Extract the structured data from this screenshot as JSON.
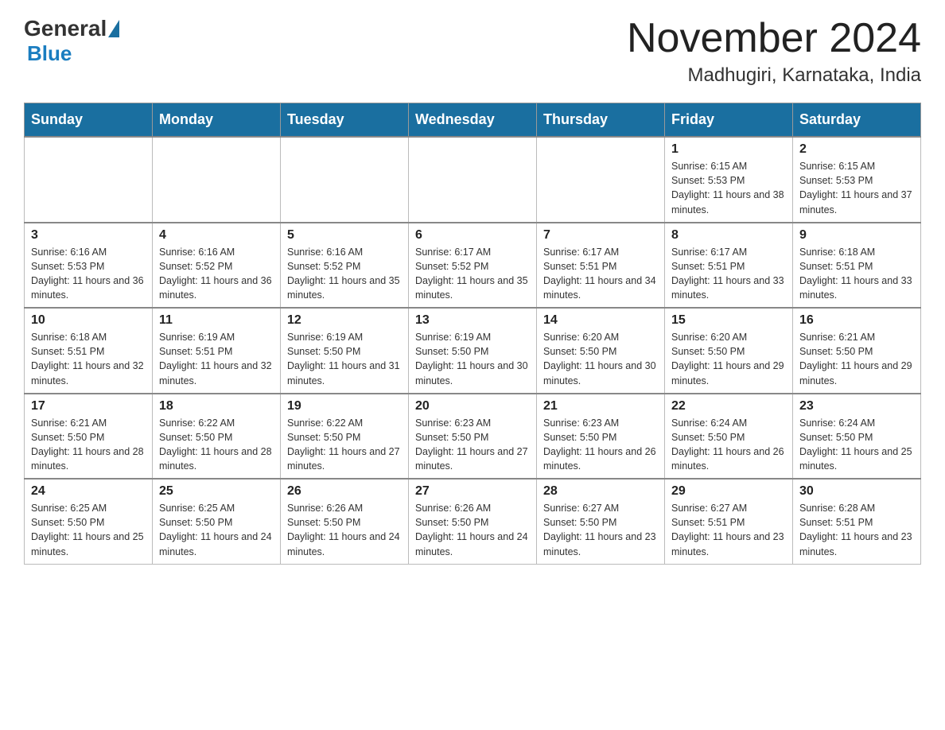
{
  "header": {
    "logo_general": "General",
    "logo_blue": "Blue",
    "month_year": "November 2024",
    "location": "Madhugiri, Karnataka, India"
  },
  "weekdays": [
    "Sunday",
    "Monday",
    "Tuesday",
    "Wednesday",
    "Thursday",
    "Friday",
    "Saturday"
  ],
  "weeks": [
    [
      {
        "day": "",
        "info": ""
      },
      {
        "day": "",
        "info": ""
      },
      {
        "day": "",
        "info": ""
      },
      {
        "day": "",
        "info": ""
      },
      {
        "day": "",
        "info": ""
      },
      {
        "day": "1",
        "info": "Sunrise: 6:15 AM\nSunset: 5:53 PM\nDaylight: 11 hours and 38 minutes."
      },
      {
        "day": "2",
        "info": "Sunrise: 6:15 AM\nSunset: 5:53 PM\nDaylight: 11 hours and 37 minutes."
      }
    ],
    [
      {
        "day": "3",
        "info": "Sunrise: 6:16 AM\nSunset: 5:53 PM\nDaylight: 11 hours and 36 minutes."
      },
      {
        "day": "4",
        "info": "Sunrise: 6:16 AM\nSunset: 5:52 PM\nDaylight: 11 hours and 36 minutes."
      },
      {
        "day": "5",
        "info": "Sunrise: 6:16 AM\nSunset: 5:52 PM\nDaylight: 11 hours and 35 minutes."
      },
      {
        "day": "6",
        "info": "Sunrise: 6:17 AM\nSunset: 5:52 PM\nDaylight: 11 hours and 35 minutes."
      },
      {
        "day": "7",
        "info": "Sunrise: 6:17 AM\nSunset: 5:51 PM\nDaylight: 11 hours and 34 minutes."
      },
      {
        "day": "8",
        "info": "Sunrise: 6:17 AM\nSunset: 5:51 PM\nDaylight: 11 hours and 33 minutes."
      },
      {
        "day": "9",
        "info": "Sunrise: 6:18 AM\nSunset: 5:51 PM\nDaylight: 11 hours and 33 minutes."
      }
    ],
    [
      {
        "day": "10",
        "info": "Sunrise: 6:18 AM\nSunset: 5:51 PM\nDaylight: 11 hours and 32 minutes."
      },
      {
        "day": "11",
        "info": "Sunrise: 6:19 AM\nSunset: 5:51 PM\nDaylight: 11 hours and 32 minutes."
      },
      {
        "day": "12",
        "info": "Sunrise: 6:19 AM\nSunset: 5:50 PM\nDaylight: 11 hours and 31 minutes."
      },
      {
        "day": "13",
        "info": "Sunrise: 6:19 AM\nSunset: 5:50 PM\nDaylight: 11 hours and 30 minutes."
      },
      {
        "day": "14",
        "info": "Sunrise: 6:20 AM\nSunset: 5:50 PM\nDaylight: 11 hours and 30 minutes."
      },
      {
        "day": "15",
        "info": "Sunrise: 6:20 AM\nSunset: 5:50 PM\nDaylight: 11 hours and 29 minutes."
      },
      {
        "day": "16",
        "info": "Sunrise: 6:21 AM\nSunset: 5:50 PM\nDaylight: 11 hours and 29 minutes."
      }
    ],
    [
      {
        "day": "17",
        "info": "Sunrise: 6:21 AM\nSunset: 5:50 PM\nDaylight: 11 hours and 28 minutes."
      },
      {
        "day": "18",
        "info": "Sunrise: 6:22 AM\nSunset: 5:50 PM\nDaylight: 11 hours and 28 minutes."
      },
      {
        "day": "19",
        "info": "Sunrise: 6:22 AM\nSunset: 5:50 PM\nDaylight: 11 hours and 27 minutes."
      },
      {
        "day": "20",
        "info": "Sunrise: 6:23 AM\nSunset: 5:50 PM\nDaylight: 11 hours and 27 minutes."
      },
      {
        "day": "21",
        "info": "Sunrise: 6:23 AM\nSunset: 5:50 PM\nDaylight: 11 hours and 26 minutes."
      },
      {
        "day": "22",
        "info": "Sunrise: 6:24 AM\nSunset: 5:50 PM\nDaylight: 11 hours and 26 minutes."
      },
      {
        "day": "23",
        "info": "Sunrise: 6:24 AM\nSunset: 5:50 PM\nDaylight: 11 hours and 25 minutes."
      }
    ],
    [
      {
        "day": "24",
        "info": "Sunrise: 6:25 AM\nSunset: 5:50 PM\nDaylight: 11 hours and 25 minutes."
      },
      {
        "day": "25",
        "info": "Sunrise: 6:25 AM\nSunset: 5:50 PM\nDaylight: 11 hours and 24 minutes."
      },
      {
        "day": "26",
        "info": "Sunrise: 6:26 AM\nSunset: 5:50 PM\nDaylight: 11 hours and 24 minutes."
      },
      {
        "day": "27",
        "info": "Sunrise: 6:26 AM\nSunset: 5:50 PM\nDaylight: 11 hours and 24 minutes."
      },
      {
        "day": "28",
        "info": "Sunrise: 6:27 AM\nSunset: 5:50 PM\nDaylight: 11 hours and 23 minutes."
      },
      {
        "day": "29",
        "info": "Sunrise: 6:27 AM\nSunset: 5:51 PM\nDaylight: 11 hours and 23 minutes."
      },
      {
        "day": "30",
        "info": "Sunrise: 6:28 AM\nSunset: 5:51 PM\nDaylight: 11 hours and 23 minutes."
      }
    ]
  ]
}
